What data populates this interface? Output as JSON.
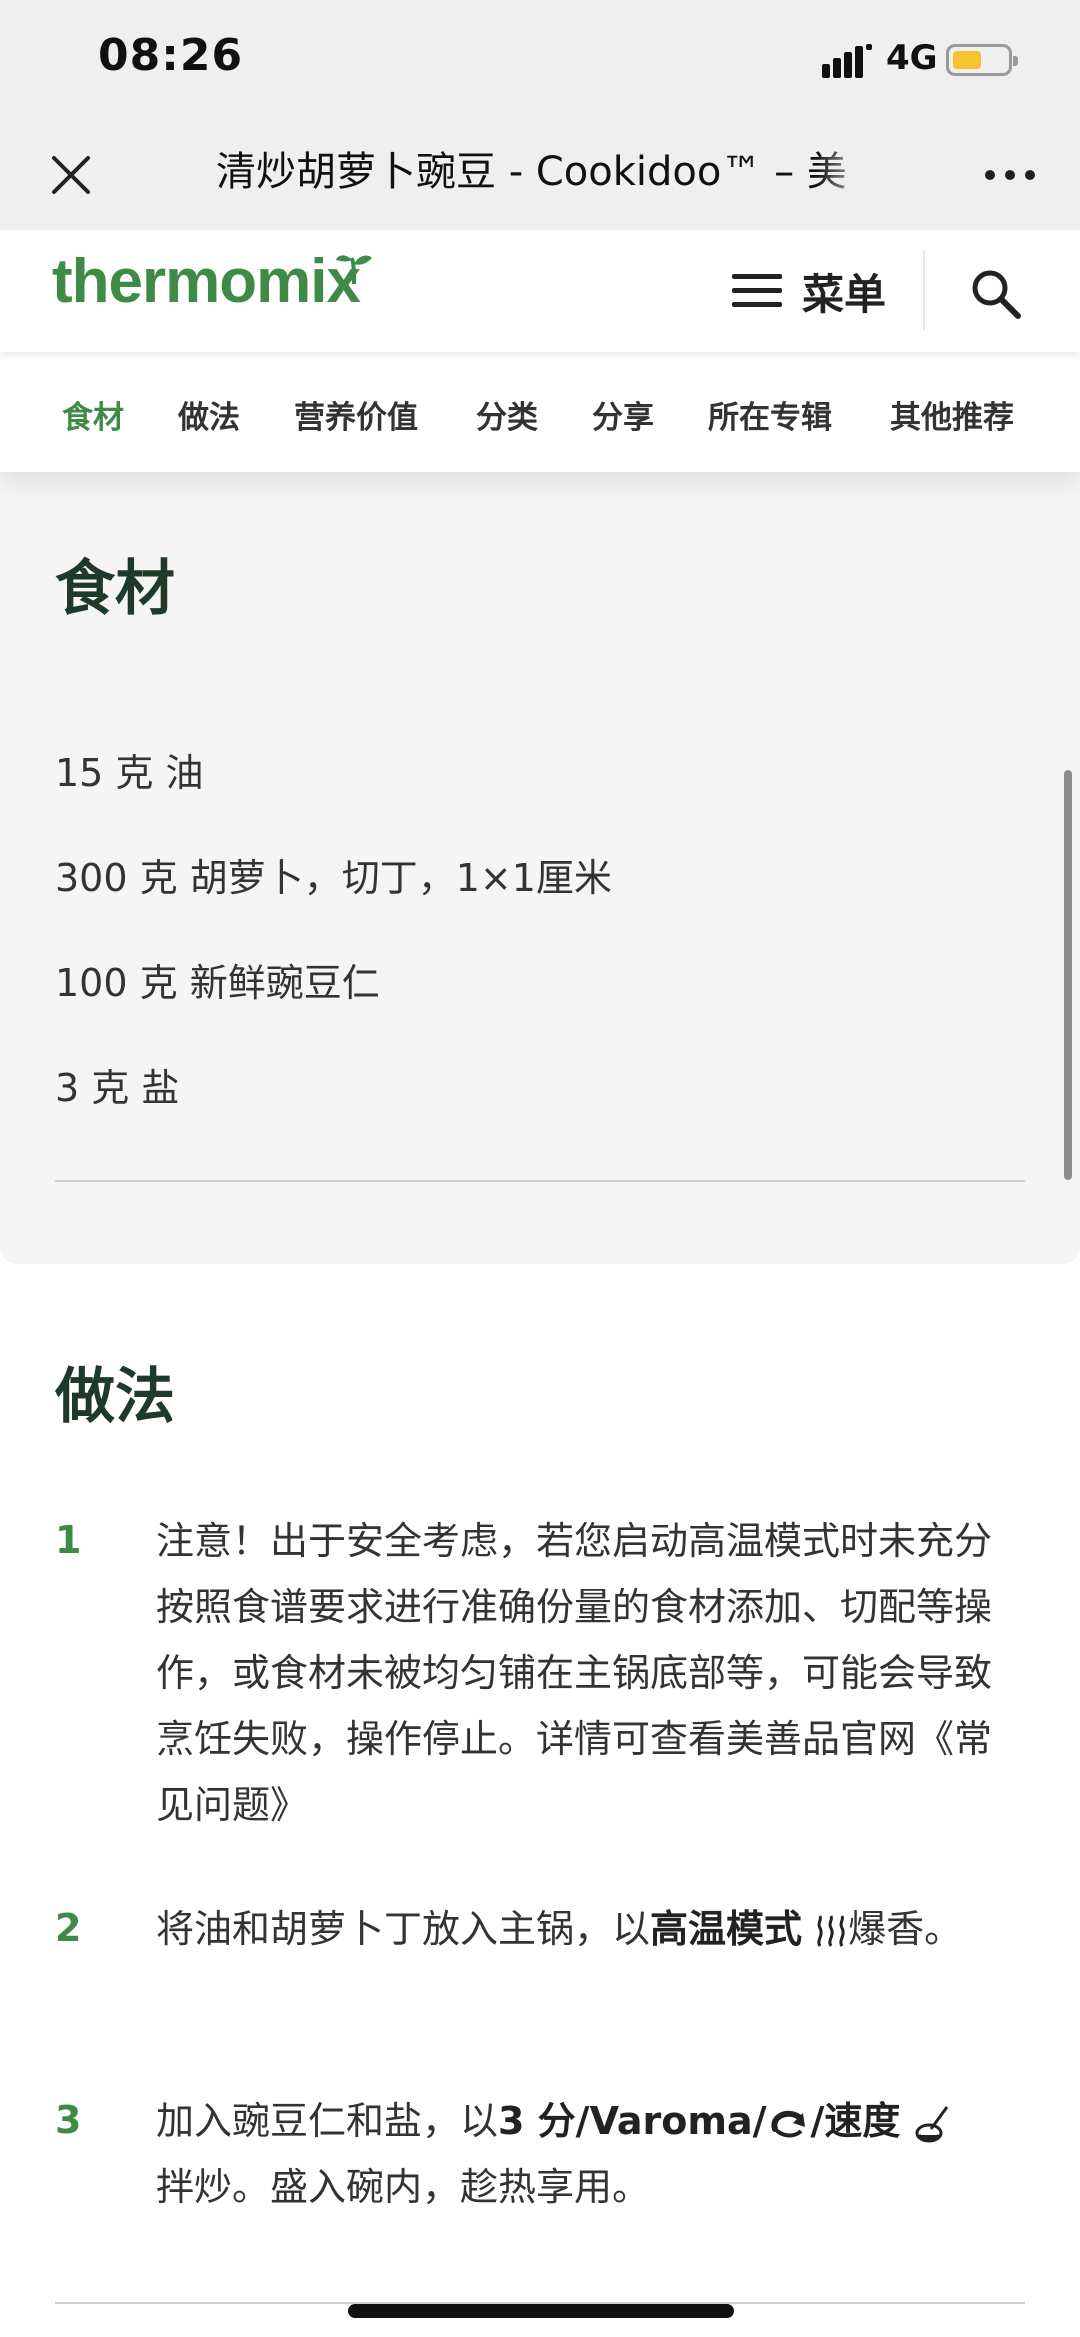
{
  "status": {
    "time": "08:26",
    "network": "4G"
  },
  "browser": {
    "title": "清炒胡萝卜豌豆 - Cookidoo™ – 美"
  },
  "header": {
    "logo": "thermomix",
    "menu_label": "菜单"
  },
  "tabs": [
    {
      "label": "食材",
      "active": true
    },
    {
      "label": "做法"
    },
    {
      "label": "营养价值"
    },
    {
      "label": "分类"
    },
    {
      "label": "分享"
    },
    {
      "label": "所在专辑"
    },
    {
      "label": "其他推荐"
    }
  ],
  "ingredients": {
    "title": "食材",
    "items": [
      "15 克 油",
      "300 克 胡萝卜，切丁，1×1厘米",
      "100 克 新鲜豌豆仁",
      "3 克 盐"
    ]
  },
  "steps": {
    "title": "做法",
    "items": [
      {
        "num": "1",
        "text": "注意！出于安全考虑，若您启动高温模式时未充分按照食谱要求进行准确份量的食材添加、切配等操作，或食材未被均匀铺在主锅底部等，可能会导致烹饪失败，操作停止。详情可查看美善品官网《常见问题》"
      },
      {
        "num": "2",
        "text_a": "将油和胡萝卜丁放入主锅，以",
        "bold": "高温模式",
        "text_b": "爆香。"
      },
      {
        "num": "3",
        "text_a": "加入豌豆仁和盐，以",
        "bold_a": "3 分/Varoma/",
        "bold_b": "/速度",
        "text_b": "拌炒。盛入碗内，趁热享用。"
      }
    ]
  },
  "colors": {
    "brand_green": "#3f8a47",
    "heading": "#1f3a2a",
    "battery": "#f4c430"
  }
}
